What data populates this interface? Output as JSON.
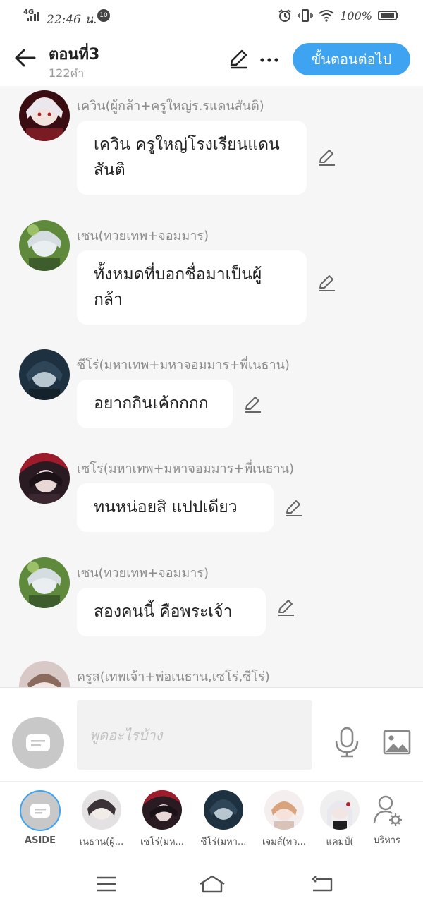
{
  "status_bar": {
    "network": "4G",
    "time": "22:46 น.",
    "badge": "10",
    "battery": "100%"
  },
  "header": {
    "title": "ตอนที่3",
    "word_count": "122คำ",
    "next_button": "ขั้นตอนต่อไป"
  },
  "messages": [
    {
      "speaker": "เควิน(ผู้กล้า+ครูใหญ่ร.รแดนสันติ)",
      "text": "เควิน ครูใหญ่โรงเรียนแดนสันติ"
    },
    {
      "speaker": "เซน(ทวยเทพ+จอมมาร)",
      "text": "ทั้งหมดที่บอกชื่อมาเป็นผู้กล้า"
    },
    {
      "speaker": "ซีโร่(มหาเทพ+มหาจอมมาร+พี่เนธาน)",
      "text": "อยากกินเค้กกกก"
    },
    {
      "speaker": "เซโร่(มหาเทพ+มหาจอมมาร+พี่เนธาน)",
      "text": "ทนหน่อยสิ แปปเดียว"
    },
    {
      "speaker": "เซน(ทวยเทพ+จอมมาร)",
      "text": "สองคนนี้ คือพระเจ้า"
    },
    {
      "speaker": "ครูส(เทพเจ้า+พ่อเนธาน,เซโร่,ซีโร่)",
      "text": ""
    }
  ],
  "composer": {
    "placeholder": "พูดอะไรบ้าง"
  },
  "characters": [
    {
      "name": "ASIDE"
    },
    {
      "name": "เนธาน(ผู้..."
    },
    {
      "name": "เซโร่(มห..."
    },
    {
      "name": "ซีโร่(มหา..."
    },
    {
      "name": "เจมส์(ทว..."
    },
    {
      "name": "แคมป์("
    },
    {
      "name": "บริหาร"
    }
  ],
  "colors": {
    "accent": "#3ea3f1",
    "background": "#f6f6f6",
    "muted_text": "#8c8c8c"
  }
}
